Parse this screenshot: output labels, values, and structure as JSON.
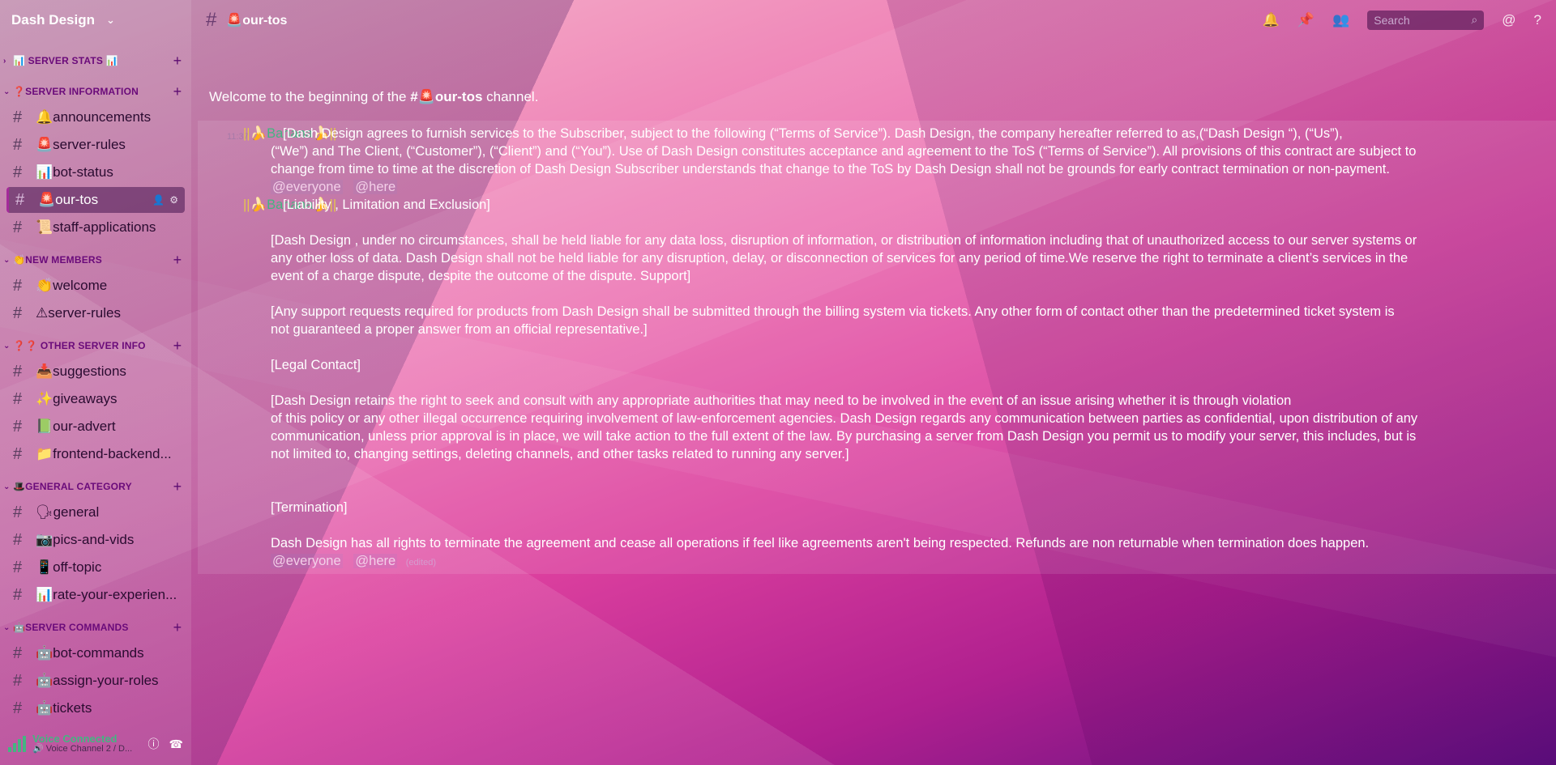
{
  "server": {
    "name": "Dash Design"
  },
  "categories": [
    {
      "label": "📊 SERVER STATS 📊",
      "collapsed": true,
      "channels": []
    },
    {
      "label": "❓SERVER INFORMATION",
      "collapsed": false,
      "channels": [
        {
          "label": "🔔announcements",
          "active": false
        },
        {
          "label": "🚨server-rules",
          "active": false
        },
        {
          "label": "📊bot-status",
          "active": false
        },
        {
          "label": "🚨our-tos",
          "active": true
        },
        {
          "label": "📜staff-applications",
          "active": false
        }
      ]
    },
    {
      "label": "👏NEW MEMBERS",
      "collapsed": false,
      "channels": [
        {
          "label": "👏welcome",
          "active": false
        },
        {
          "label": "⚠server-rules",
          "active": false
        }
      ]
    },
    {
      "label": "❓❓ OTHER SERVER INFO",
      "collapsed": false,
      "channels": [
        {
          "label": "📥suggestions",
          "active": false
        },
        {
          "label": "✨giveaways",
          "active": false
        },
        {
          "label": "📗our-advert",
          "active": false
        },
        {
          "label": "📁frontend-backend...",
          "active": false
        }
      ]
    },
    {
      "label": "🎩GENERAL CATEGORY",
      "collapsed": false,
      "channels": [
        {
          "label": "🗣general",
          "active": false
        },
        {
          "label": "📷pics-and-vids",
          "active": false
        },
        {
          "label": "📱off-topic",
          "active": false
        },
        {
          "label": "📊rate-your-experien...",
          "active": false
        }
      ]
    },
    {
      "label": "🤖SERVER COMMANDS",
      "collapsed": false,
      "channels": [
        {
          "label": "🤖bot-commands",
          "active": false
        },
        {
          "label": "🤖assign-your-roles",
          "active": false
        },
        {
          "label": "🤖tickets",
          "active": false
        }
      ]
    }
  ],
  "voice": {
    "status": "Voice Connected",
    "channel": "🔊 Voice Channel 2 / D..."
  },
  "topbar": {
    "channel": "🚨our-tos",
    "search_placeholder": "Search"
  },
  "welcome": {
    "prefix": "Welcome to the beginning of the ",
    "channel": "#🚨our-tos",
    "suffix": " channel."
  },
  "messages": [
    {
      "time": "11:37",
      "author": "🍌Banana🍌",
      "lines": [
        "[Dash Design agrees to furnish services to the Subscriber, subject to the following (“Terms of Service”). Dash Design, the company hereafter referred to as,(“Dash Design “), (“Us”),",
        "(“We”) and The Client, (“Customer”), (“Client”) and (“You”). Use of Dash Design constitutes acceptance and agreement to the ToS (“Terms of Service”). All provisions of this contract are subject to",
        "change from time to time at the discretion of Dash Design Subscriber understands that change to the ToS by Dash Design  shall not be grounds for early contract termination or non-payment."
      ],
      "mentions": [
        "@everyone",
        "@here"
      ]
    },
    {
      "author": "🍌Banana🍌",
      "title": "[Liability , Limitation and Exclusion]",
      "paragraphs": [
        [
          "[Dash Design , under no circumstances, shall be held liable for any data loss, disruption of information, or distribution of information including that of unauthorized access to our server systems or",
          "any other loss of data. Dash Design shall not be held liable for any disruption, delay, or disconnection of services for any period of time.We reserve the right to terminate a client’s services in the",
          "event of a charge dispute, despite the outcome of the dispute. Support]"
        ],
        [
          "[Any support requests required for products from Dash Design shall be submitted through the billing system via tickets. Any other form of contact other than the predetermined ticket system is",
          "not guaranteed a proper answer from an official representative.]"
        ],
        [
          "[Legal Contact]"
        ],
        [
          "[Dash Design retains the right to seek and consult with any appropriate authorities that may need to be involved in the event of an issue arising whether it is through violation",
          "of this policy or any other illegal occurrence requiring involvement of law-enforcement agencies. Dash Design regards any communication between parties as confidential, upon distribution of any",
          "communication, unless prior approval is in place, we will take action to the full extent of the law. By purchasing a server from Dash Design you permit us to modify your server, this includes, but is",
          "not limited to, changing settings, deleting channels, and other tasks related to running any server.]"
        ],
        [
          "[Termination]"
        ],
        [
          "Dash Design has all rights to terminate the agreement and cease all operations if feel like agreements aren't being respected. Refunds are non returnable when termination does happen."
        ]
      ],
      "mentions": [
        "@everyone",
        "@here"
      ],
      "edited": "(edited)"
    }
  ]
}
